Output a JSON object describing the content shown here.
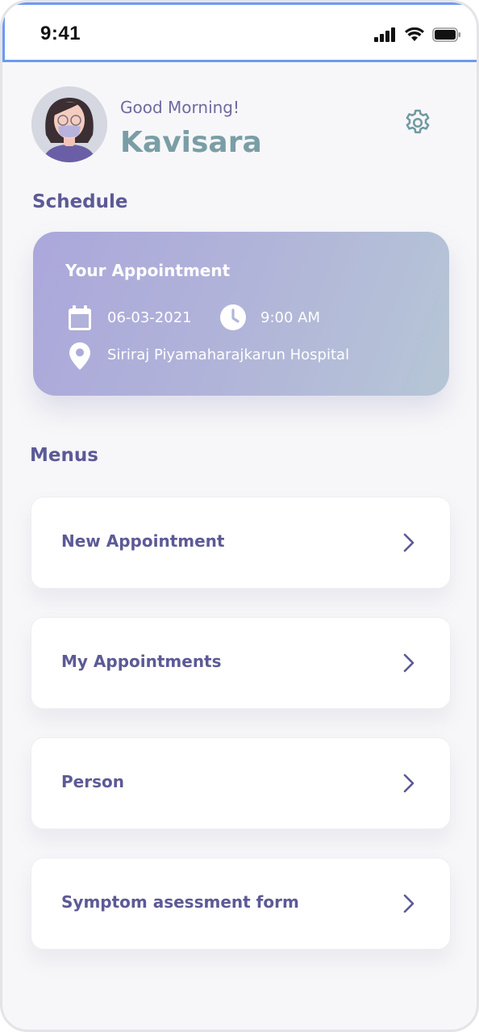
{
  "status_bar": {
    "time": "9:41",
    "icons": [
      "signal-icon",
      "wifi-icon",
      "battery-icon"
    ]
  },
  "header": {
    "greeting": "Good Morning!",
    "username": "Kavisara",
    "settings_icon": "gear-icon"
  },
  "schedule": {
    "section_title": "Schedule",
    "card": {
      "title": "Your Appointment",
      "date": "06-03-2021",
      "time": "9:00 AM",
      "location": "Siriraj Piyamaharajkarun Hospital",
      "icons": [
        "calendar-icon",
        "clock-icon",
        "location-pin-icon"
      ]
    }
  },
  "menus": {
    "section_title": "Menus",
    "items": [
      {
        "label": "New Appointment"
      },
      {
        "label": "My Appointments"
      },
      {
        "label": "Person"
      },
      {
        "label": "Symptom asessment form"
      }
    ]
  },
  "colors": {
    "primary_text": "#5c5a96",
    "username": "#7a9ea6",
    "card_gradient_start": "#aba7db",
    "card_gradient_end": "#b6c6d6"
  }
}
